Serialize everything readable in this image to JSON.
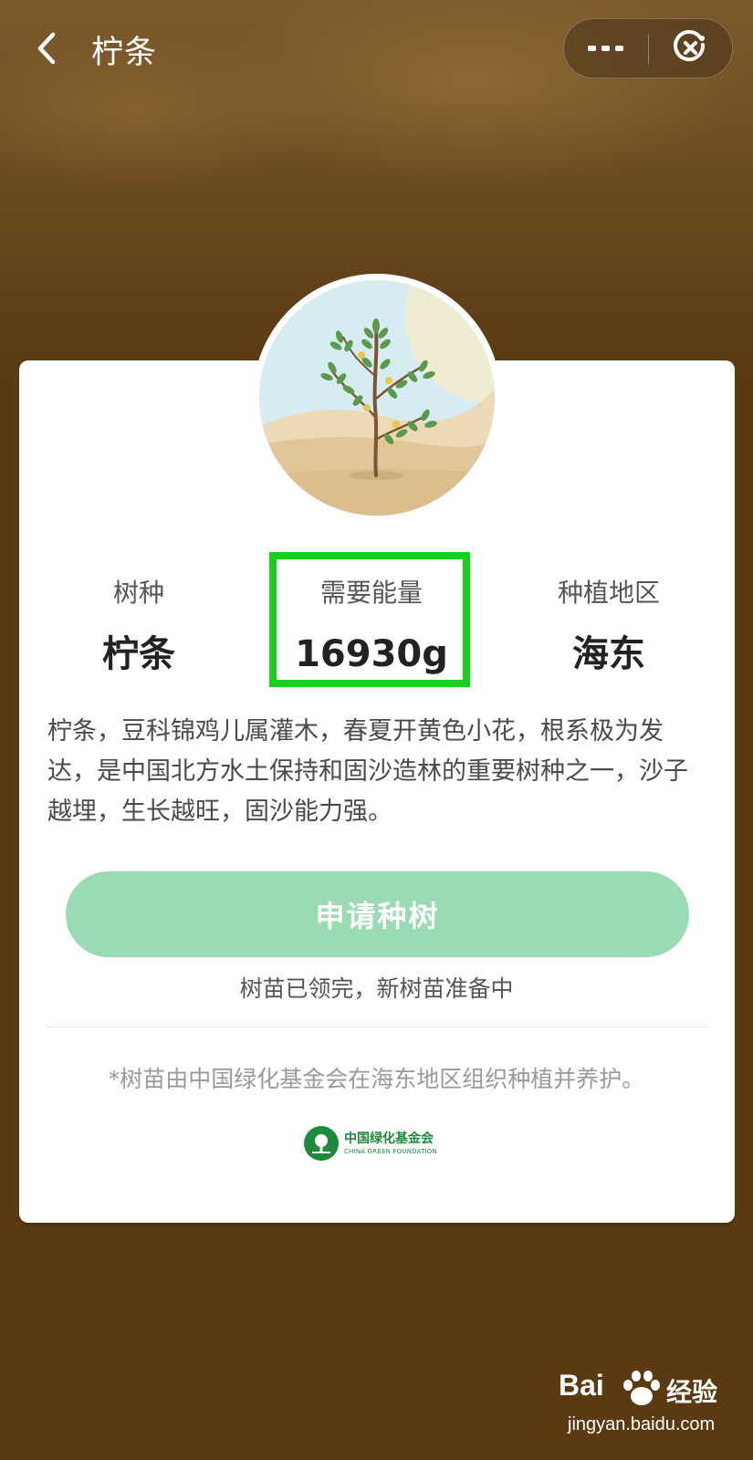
{
  "header": {
    "title": "柠条"
  },
  "tree": {
    "species_label": "树种",
    "species_value": "柠条",
    "energy_label": "需要能量",
    "energy_value": "16930g",
    "region_label": "种植地区",
    "region_value": "海东",
    "description": "柠条，豆科锦鸡儿属灌木，春夏开黄色小花，根系极为发达，是中国北方水土保持和固沙造林的重要树种之一，沙子越埋，生长越旺，固沙能力强。"
  },
  "actions": {
    "apply_label": "申请种树",
    "status_text": "树苗已领完，新树苗准备中"
  },
  "footer": {
    "note": "*树苗由中国绿化基金会在海东地区组织种植并养护。",
    "logo_cn": "中国绿化基金会",
    "logo_en": "CHINA GREEN FOUNDATION"
  },
  "watermark": {
    "brand": "Bai",
    "brand_cn": "经验",
    "url": "jingyan.baidu.com"
  },
  "colors": {
    "background": "#5b3a12",
    "button": "#9adbb4",
    "highlight": "#17d01a",
    "foundation_green": "#1e8a3c"
  }
}
